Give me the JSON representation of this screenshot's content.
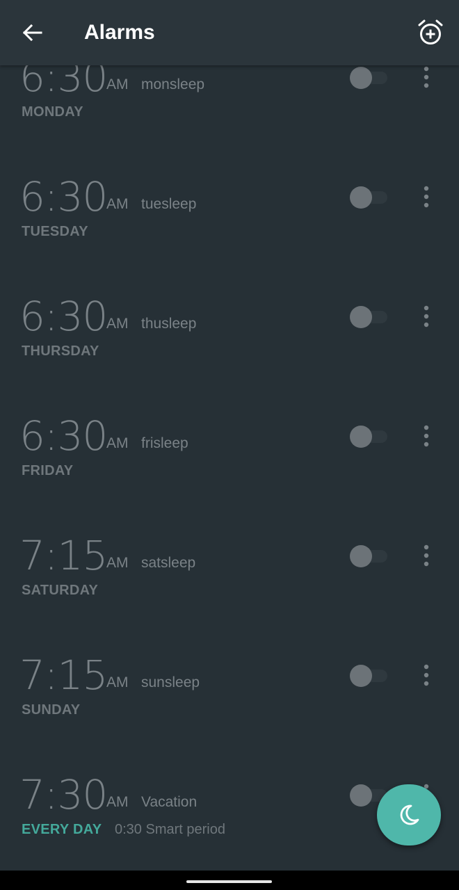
{
  "header": {
    "title": "Alarms",
    "back_icon": "arrow-left-icon",
    "add_icon": "alarm-add-icon"
  },
  "alarms": [
    {
      "time": "6:30",
      "ampm": "AM",
      "label": "monsleep",
      "days": "MONDAY",
      "enabled": false
    },
    {
      "time": "6:30",
      "ampm": "AM",
      "label": "tuesleep",
      "days": "TUESDAY",
      "enabled": false
    },
    {
      "time": "6:30",
      "ampm": "AM",
      "label": "thusleep",
      "days": "THURSDAY",
      "enabled": false
    },
    {
      "time": "6:30",
      "ampm": "AM",
      "label": "frisleep",
      "days": "FRIDAY",
      "enabled": false
    },
    {
      "time": "7:15",
      "ampm": "AM",
      "label": "satsleep",
      "days": "SATURDAY",
      "enabled": false
    },
    {
      "time": "7:15",
      "ampm": "AM",
      "label": "sunsleep",
      "days": "SUNDAY",
      "enabled": false
    },
    {
      "time": "7:30",
      "ampm": "AM",
      "label": "Vacation",
      "days": "EVERY DAY",
      "smart_period": "0:30 Smart period",
      "enabled": false
    }
  ],
  "fab": {
    "icon": "moon-icon"
  },
  "colors": {
    "background": "#263036",
    "header": "#2b353b",
    "accent": "#4fb7aa",
    "every_day": "#44a99b",
    "muted_text": "#7a8287"
  }
}
